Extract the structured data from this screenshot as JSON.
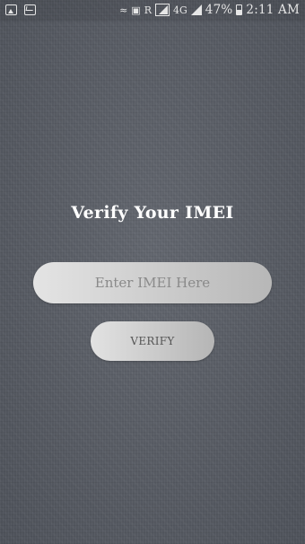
{
  "status_bar": {
    "notification_icons": [
      "image-icon",
      "mail-icon"
    ],
    "battery_percent": "47%",
    "time": "2:11 AM",
    "indicator_r": "R",
    "indicator_4g": "4G"
  },
  "main": {
    "title": "Verify Your IMEI",
    "imei_input": {
      "placeholder": "Enter IMEI Here",
      "value": ""
    },
    "verify_label": "VERIFY"
  },
  "colors": {
    "background": "#575b63",
    "title_text": "#ffffff",
    "control_gradient_start": "#e4e4e4",
    "control_gradient_end": "#b7b7b7",
    "button_text": "#555555"
  }
}
